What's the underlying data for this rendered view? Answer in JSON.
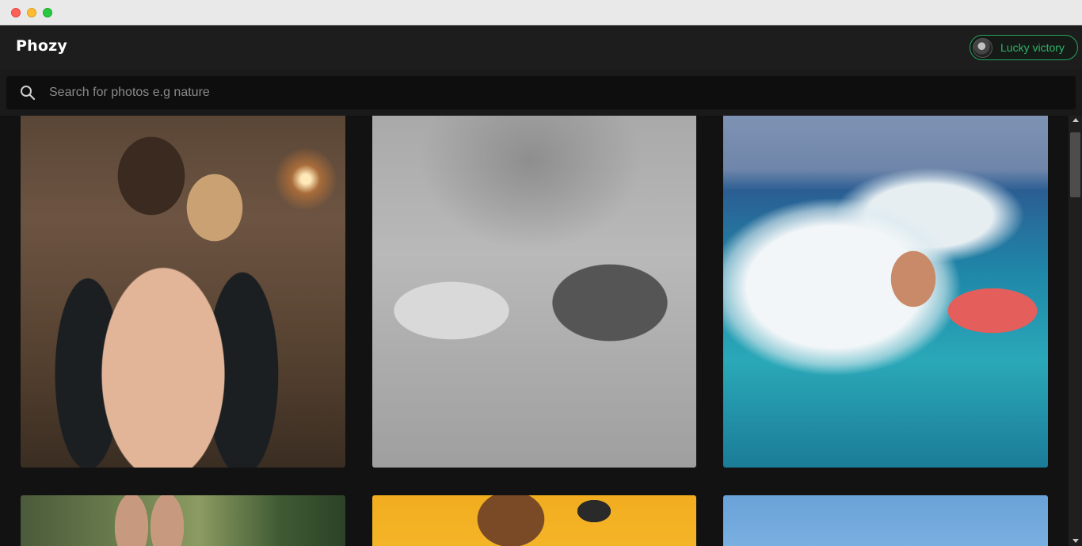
{
  "app": {
    "brand": "Phozy"
  },
  "user": {
    "name": "Lucky victory",
    "accent_color": "#2fb369"
  },
  "search": {
    "placeholder": "Search for photos e.g nature",
    "value": ""
  },
  "icons": {
    "search": "search-icon",
    "avatar": "user-avatar"
  },
  "gallery": {
    "photos": [
      {
        "alt": "wedding-couple-embrace"
      },
      {
        "alt": "black-and-white-holding-hands"
      },
      {
        "alt": "kitesurfer-on-wave"
      },
      {
        "alt": "raised-hands-outdoors"
      },
      {
        "alt": "woman-with-sunglasses-yellow-background"
      },
      {
        "alt": "blue-sky"
      }
    ]
  },
  "colors": {
    "header_bg": "#1d1d1d",
    "page_bg": "#121212",
    "search_bg": "#0e0e0e"
  }
}
